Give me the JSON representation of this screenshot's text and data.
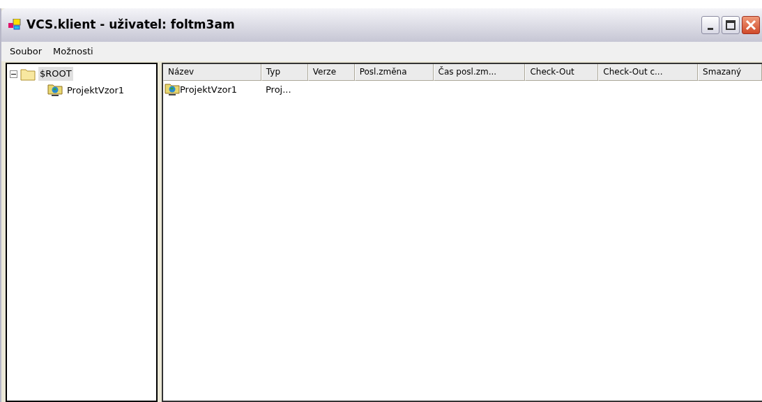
{
  "window": {
    "title": "VCS.klient - uživatel: foltm3am"
  },
  "menu": [
    {
      "label": "Soubor"
    },
    {
      "label": "Možnosti"
    }
  ],
  "tree": [
    {
      "label": "$ROOT",
      "kind": "folder",
      "selected": true,
      "expanded": true,
      "children": [
        {
          "label": "ProjektVzor1",
          "kind": "project",
          "selected": false
        }
      ]
    }
  ],
  "table": {
    "columns": [
      "Název",
      "Typ",
      "Verze",
      "Posl.změna",
      "Čas posl.zm...",
      "Check-Out",
      "Check-Out c...",
      "Smazaný"
    ],
    "rows": [
      {
        "kind": "project",
        "cells": [
          "ProjektVzor1",
          "Proj..."
        ]
      }
    ]
  }
}
